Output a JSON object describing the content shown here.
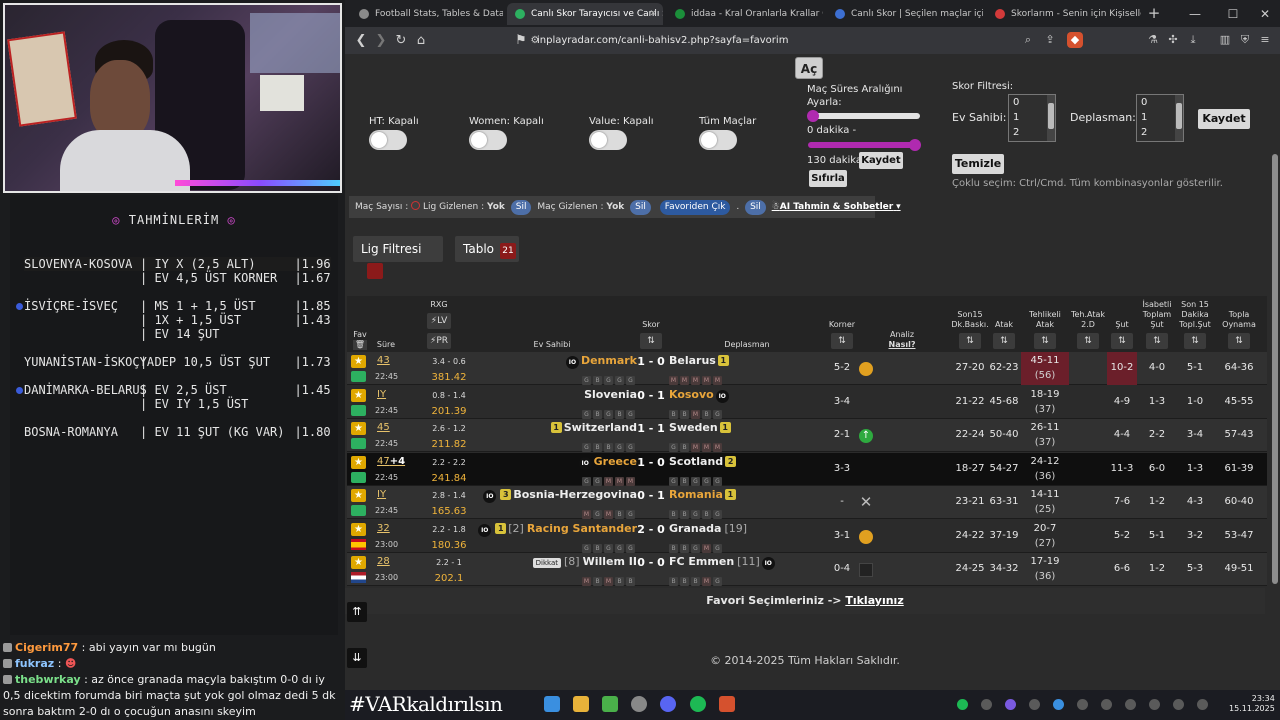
{
  "colors": {
    "accent_purple": "#b02ab0",
    "header_dark": "#242424",
    "red_cell": "#6b1f2a",
    "star_gold": "#e0a800",
    "taskbar": "#1b1c22"
  },
  "tahminler": {
    "title": "TAHMİNLERİM",
    "lines": [
      {
        "match": "SLOVENYA-KOSOVA",
        "pick": "IY X (2,5 ALT)",
        "odd": "|1.96"
      },
      {
        "match": "",
        "pick": "EV 4,5 ÜST KORNER",
        "odd": "|1.67"
      },
      {
        "match": "İSVİÇRE-İSVEÇ",
        "pick": "MS 1 + 1,5 ÜST",
        "odd": "|1.85"
      },
      {
        "match": "",
        "pick": "1X + 1,5 ÜST",
        "odd": "|1.43"
      },
      {
        "match": "",
        "pick": "EV 14 ŞUT",
        "odd": ""
      },
      {
        "match": "YUNANİSTAN-İSKOÇYA",
        "pick": "DEP 10,5 ÜST ŞUT",
        "odd": "|1.73"
      },
      {
        "match": "DANİMARKA-BELARUS",
        "pick": "EV 2,5 ÜST",
        "odd": "|1.45"
      },
      {
        "match": "",
        "pick": "EV IY 1,5 ÜST",
        "odd": ""
      },
      {
        "match": "BOSNA-ROMANYA",
        "pick": "EV 11 ŞUT (KG VAR)",
        "odd": "|1.80"
      }
    ]
  },
  "chat": [
    {
      "user": "Cigerim77",
      "text": ": abi yayın var mı bugün"
    },
    {
      "user": "fukraz",
      "text": ":"
    },
    {
      "user": "thebwrkay",
      "text": ": az önce granada maçyla bakıştım 0-0 dı iy 0,5 dicektim forumda biri maçta şut yok gol olmaz dedi 5 dk sonra baktım 2-0 dı o çocuğun anasını skeyim"
    }
  ],
  "browser": {
    "tabs": [
      {
        "label": "Football Stats, Tables & Data | Socc"
      },
      {
        "label": "Canlı Skor Tarayıcısı ve Canlı Sk"
      },
      {
        "label": "iddaa - Kral Oranlarla Krallar Gibi K"
      },
      {
        "label": "Canlı Skor | Seçilen maçlar için canl"
      },
      {
        "label": "Skorlarım - Senin için Kişiselleştiril"
      }
    ],
    "url": "inplayradar.com/canli-bahisv2.php?sayfa=favorim"
  },
  "filters": {
    "ac": "Aç",
    "ht": "HT: Kapalı",
    "women": "Women: Kapalı",
    "value": "Value: Kapalı",
    "tum": "Tüm Maçlar",
    "sure_title": "Maç Süres Aralığını Ayarla:",
    "sure_min": "0 dakika -",
    "sure_max": "130 dakika",
    "kaydet": "Kaydet",
    "sifirla": "Sıfırla",
    "skor_title": "Skor Filtresi:",
    "ev_sahibi": "Ev Sahibi:",
    "deplasman": "Deplasman:",
    "opts": [
      "0",
      "1",
      "2"
    ],
    "temizle": "Temizle",
    "hint": "Çoklu seçim: Ctrl/Cmd. Tüm kombinasyonlar gösterilir."
  },
  "controls": {
    "mac_sayisi": "Maç Sayısı :",
    "lig_gizlenen": "Lig Gizlenen :",
    "yok1": "Yok",
    "sil": "Sil",
    "mac_gizlenen": "Maç Gizlenen :",
    "yok2": "Yok",
    "favoriden_cik": "Favoriden Çık",
    "dot": ".",
    "ai": "AI Tahmin & Sohbetler",
    "lig_filtresi": "Lig Filtresi",
    "tablo": "Tablo",
    "tablo_count": "21"
  },
  "table": {
    "headers": {
      "fav": "Fav",
      "sure": "Süre",
      "rxg": "RXG",
      "lv": "LV",
      "pr": "PR",
      "ev": "Ev Sahibi",
      "skor": "Skor",
      "dep": "Deplasman",
      "korner": "Korner",
      "analiz": "Analiz",
      "nasil": "Nasıl?",
      "son15": "Son15 Dk.Baskı.",
      "atak": "Atak",
      "tehlikeli": "Tehlikeli Atak",
      "tehatak": "Teh.Atak 2.D",
      "sut": "Şut",
      "isabetli": "İsabetli Toplam Şut",
      "son15sut": "Son 15 Dakika Topl.Şut",
      "topla": "Topla Oynama"
    },
    "rows": [
      {
        "min": "43",
        "time": "22:45",
        "rxg": "3.4 - 0.6",
        "rxg2": "381.42",
        "home": "Denmark",
        "home_hl": true,
        "away": "Belarus",
        "away_hl": false,
        "score": "1 - 0",
        "home_badge": "IO",
        "away_badge": "1",
        "home_forms": [
          "G",
          "B",
          "G",
          "G",
          "G"
        ],
        "away_forms": [
          "M",
          "M",
          "M",
          "M",
          "M"
        ],
        "korner": "5-2",
        "analiz": "bag",
        "son15": "27-20",
        "atak": "62-23",
        "teh": "45-11",
        "teh2": "(56)",
        "sut": "10-2",
        "isabetli": "4-0",
        "son15sut": "5-1",
        "topla": "64-36",
        "red": true
      },
      {
        "min": "IY",
        "time": "22:45",
        "rxg": "0.8 - 1.4",
        "rxg2": "201.39",
        "home": "Slovenia",
        "home_hl": false,
        "away": "Kosovo",
        "away_hl": true,
        "score": "0 - 1",
        "home_badge": "",
        "away_badge": "IO",
        "home_forms": [
          "G",
          "B",
          "G",
          "B",
          "G"
        ],
        "away_forms": [
          "B",
          "B",
          "M",
          "B",
          "G"
        ],
        "korner": "3-4",
        "analiz": "",
        "son15": "21-22",
        "atak": "45-68",
        "teh": "18-19",
        "teh2": "(37)",
        "sut": "4-9",
        "isabetli": "1-3",
        "son15sut": "1-0",
        "topla": "45-55",
        "red": false
      },
      {
        "min": "45",
        "time": "22:45",
        "rxg": "2.6 - 1.2",
        "rxg2": "211.82",
        "home": "Switzerland",
        "home_hl": false,
        "away": "Sweden",
        "away_hl": false,
        "score": "1 - 1",
        "home_badge": "1",
        "away_badge": "1",
        "home_forms": [
          "G",
          "B",
          "B",
          "G",
          "G"
        ],
        "away_forms": [
          "G",
          "B",
          "M",
          "M",
          "M"
        ],
        "korner": "2-1",
        "analiz": "up",
        "son15": "22-24",
        "atak": "50-40",
        "teh": "26-11",
        "teh2": "(37)",
        "sut": "4-4",
        "isabetli": "2-2",
        "son15sut": "3-4",
        "topla": "57-43",
        "red": false
      },
      {
        "min": "47",
        "plus": "+4",
        "time": "22:45",
        "rxg": "2.2 - 2.2",
        "rxg2": "241.84",
        "home": "Greece",
        "home_hl": true,
        "away": "Scotland",
        "away_hl": false,
        "score": "1 - 0",
        "home_badge": "IO",
        "away_badge": "2",
        "home_forms": [
          "G",
          "G",
          "M",
          "M",
          "M"
        ],
        "away_forms": [
          "G",
          "B",
          "G",
          "G",
          "G"
        ],
        "korner": "3-3",
        "analiz": "",
        "son15": "18-27",
        "atak": "54-27",
        "teh": "24-12",
        "teh2": "(36)",
        "sut": "11-3",
        "isabetli": "6-0",
        "son15sut": "1-3",
        "topla": "61-39",
        "red": false,
        "dark": true
      },
      {
        "min": "IY",
        "time": "22:45",
        "rxg": "2.8 - 1.4",
        "rxg2": "165.63",
        "home": "Bosnia-Herzegovina",
        "home_hl": false,
        "away": "Romania",
        "away_hl": true,
        "score": "0 - 1",
        "home_badge": "IO 3",
        "away_badge": "1",
        "home_forms": [
          "M",
          "G",
          "M",
          "B",
          "G"
        ],
        "away_forms": [
          "B",
          "B",
          "G",
          "B",
          "G"
        ],
        "korner": "-",
        "analiz": "x",
        "son15": "23-21",
        "atak": "63-31",
        "teh": "14-11",
        "teh2": "(25)",
        "sut": "7-6",
        "isabetli": "1-2",
        "son15sut": "4-3",
        "topla": "60-40",
        "red": false
      },
      {
        "min": "32",
        "time": "23:00",
        "rxg": "2.2 - 1.8",
        "rxg2": "180.36",
        "home": "Racing Santander",
        "home_hl": true,
        "home_rank": "[2]",
        "away": "Granada",
        "away_hl": false,
        "away_rank": "[19]",
        "score": "2 - 0",
        "home_badge": "IO 1",
        "away_badge": "",
        "home_forms": [
          "G",
          "B",
          "G",
          "G",
          "G"
        ],
        "away_forms": [
          "B",
          "B",
          "G",
          "M",
          "G"
        ],
        "korner": "3-1",
        "analiz": "bag",
        "son15": "24-22",
        "atak": "37-19",
        "teh": "20-7",
        "teh2": "(27)",
        "sut": "5-2",
        "isabetli": "5-1",
        "son15sut": "3-2",
        "topla": "53-47",
        "red": false
      },
      {
        "min": "28",
        "time": "23:00",
        "rxg": "2.2 - 1",
        "rxg2": "202.1",
        "home": "Willem II",
        "home_hl": false,
        "home_rank": "[8]",
        "home_note": "Dikkat",
        "away": "FC Emmen",
        "away_hl": false,
        "away_rank": "[11]",
        "score": "0 - 0",
        "home_badge": "",
        "away_badge": "IO",
        "home_forms": [
          "M",
          "B",
          "M",
          "B",
          "B"
        ],
        "away_forms": [
          "B",
          "B",
          "B",
          "M",
          "G"
        ],
        "korner": "0-4",
        "analiz": "flag",
        "son15": "24-25",
        "atak": "34-32",
        "teh": "17-19",
        "teh2": "(36)",
        "sut": "6-6",
        "isabetli": "1-2",
        "son15sut": "5-3",
        "topla": "49-51",
        "red": false
      }
    ],
    "foot_text": "Favori Seçimleriniz ->",
    "foot_link": "Tıklayınız",
    "copyright": "© 2014-2025 Tüm Hakları Saklıdır."
  },
  "taskbar": {
    "hashtag": "#VARkaldırılsın",
    "time": "23:34",
    "date": "15.11.2025"
  }
}
